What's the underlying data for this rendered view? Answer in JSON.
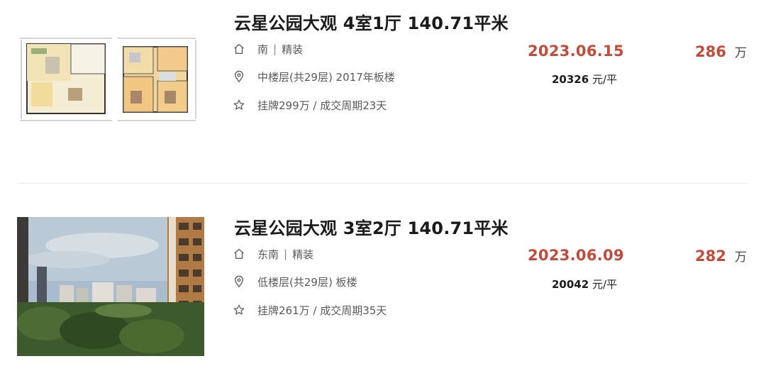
{
  "listings": [
    {
      "title": "云星公园大观 4室1厅 140.71平米",
      "orientation": "南",
      "decoration": "精装",
      "floor_info": "中楼层(共29层) 2017年板楼",
      "listing_info": "挂牌299万 / 成交周期23天",
      "deal_date": "2023.06.15",
      "unit_price": "20326",
      "unit_price_suffix": "元/平",
      "total_price": "286",
      "total_unit": "万",
      "image_type": "floorplan"
    },
    {
      "title": "云星公园大观 3室2厅 140.71平米",
      "orientation": "东南",
      "decoration": "精装",
      "floor_info": "低楼层(共29层) 板楼",
      "listing_info": "挂牌261万 / 成交周期35天",
      "deal_date": "2023.06.09",
      "unit_price": "20042",
      "unit_price_suffix": "元/平",
      "total_price": "282",
      "total_unit": "万",
      "image_type": "photo"
    }
  ],
  "separator": "|",
  "icons": {
    "orientation": "house-icon",
    "floor": "location-pin-icon",
    "listing": "star-icon"
  },
  "colors": {
    "price": "#c44a3a",
    "title": "#1a1a1a",
    "meta": "#5a5a5a"
  }
}
